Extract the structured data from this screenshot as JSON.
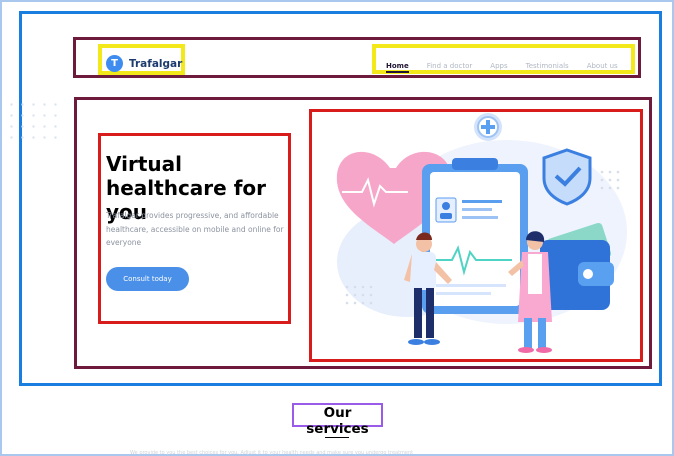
{
  "brand": {
    "name": "Trafalgar",
    "logo_letter": "T"
  },
  "nav": {
    "items": [
      "Home",
      "Find a doctor",
      "Apps",
      "Testimonials",
      "About us"
    ],
    "active": "Home"
  },
  "hero": {
    "title": "Virtual healthcare for you",
    "description": "Trafalgar provides progressive, and affordable healthcare, accessible on mobile and online for everyone",
    "cta": "Consult today"
  },
  "services": {
    "title": "Our services",
    "subtitle": "We provide to you the best choices for you. Adjust it to your health needs and make sure you undergo treatment"
  },
  "colors": {
    "accent": "#4a90e8",
    "brand_text": "#1d3b6e",
    "heart": "#f08ab8"
  }
}
